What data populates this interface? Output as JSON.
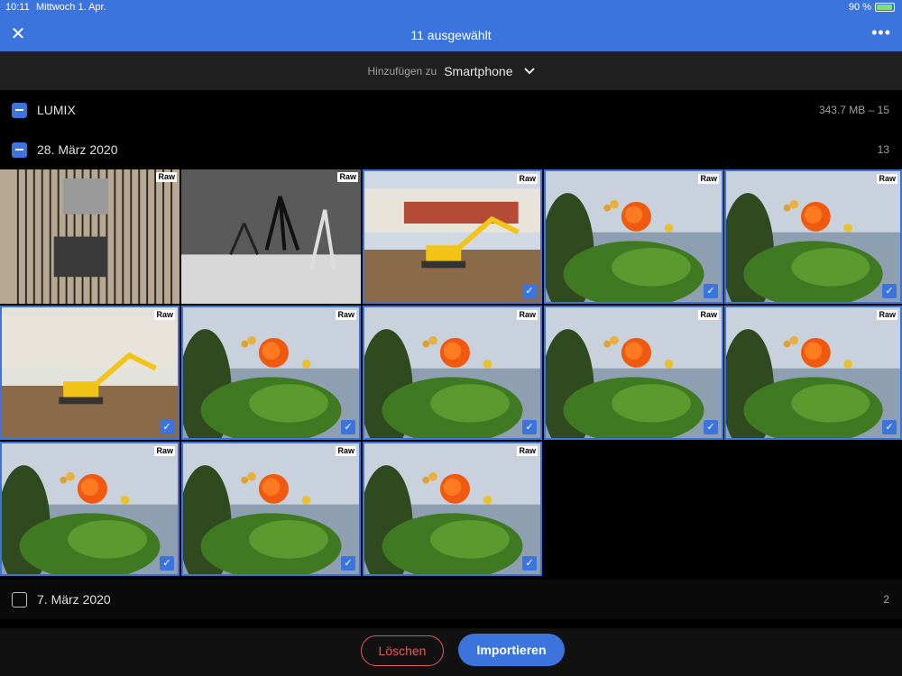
{
  "status_bar": {
    "time": "10:11",
    "date": "Mittwoch 1. Apr.",
    "battery": "90 %",
    "battery_level": 0.9
  },
  "header": {
    "close_icon": "close-icon",
    "title": "11 ausgewählt",
    "more_icon": "more-horizontal-icon"
  },
  "add_to": {
    "label": "Hinzufügen zu",
    "target": "Smartphone",
    "chevron_icon": "chevron-down-icon"
  },
  "sections": [
    {
      "name": "LUMIX",
      "meta": "343.7 MB – 15",
      "state": "partial"
    },
    {
      "name": "28. März 2020",
      "meta": "13",
      "state": "partial"
    },
    {
      "name": "7. März 2020",
      "meta": "2",
      "state": "unchecked"
    }
  ],
  "raw_badge": "Raw",
  "check_icon": "checkmark-icon",
  "photos": [
    {
      "subject": "birdcage",
      "selected": false
    },
    {
      "subject": "tripod",
      "selected": false
    },
    {
      "subject": "excavator-building",
      "selected": true
    },
    {
      "subject": "flower",
      "selected": true
    },
    {
      "subject": "flower",
      "selected": true
    },
    {
      "subject": "excavator",
      "selected": true
    },
    {
      "subject": "flower",
      "selected": true
    },
    {
      "subject": "flower",
      "selected": true
    },
    {
      "subject": "flower",
      "selected": true
    },
    {
      "subject": "flower",
      "selected": true
    },
    {
      "subject": "flower",
      "selected": true
    },
    {
      "subject": "flower",
      "selected": true
    },
    {
      "subject": "flower",
      "selected": true
    }
  ],
  "footer": {
    "delete_label": "Löschen",
    "import_label": "Importieren"
  },
  "colors": {
    "accent": "#3b74dc",
    "delete": "#e35b5b",
    "background": "#000000",
    "toolbar": "#202020"
  }
}
